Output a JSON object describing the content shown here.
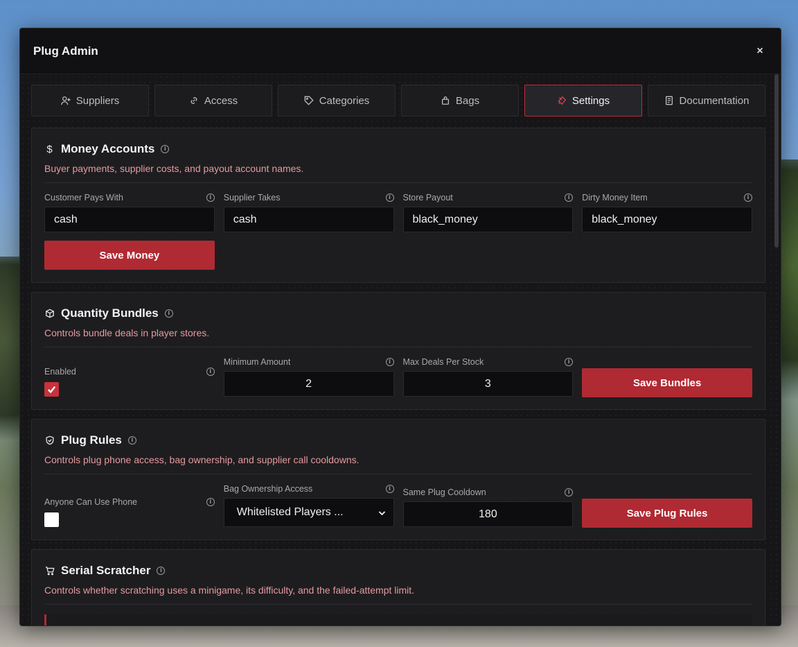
{
  "modal": {
    "title": "Plug Admin",
    "close": "×"
  },
  "tabs": [
    {
      "label": "Suppliers",
      "icon": "user-plus-icon"
    },
    {
      "label": "Access",
      "icon": "link-icon"
    },
    {
      "label": "Categories",
      "icon": "tag-icon"
    },
    {
      "label": "Bags",
      "icon": "bag-icon"
    },
    {
      "label": "Settings",
      "icon": "settings-icon",
      "active": true
    },
    {
      "label": "Documentation",
      "icon": "document-icon"
    }
  ],
  "money": {
    "title": "Money Accounts",
    "desc": "Buyer payments, supplier costs, and payout account names.",
    "fields": [
      {
        "label": "Customer Pays With",
        "value": "cash"
      },
      {
        "label": "Supplier Takes",
        "value": "cash"
      },
      {
        "label": "Store Payout",
        "value": "black_money"
      },
      {
        "label": "Dirty Money Item",
        "value": "black_money"
      }
    ],
    "save": "Save Money"
  },
  "bundles": {
    "title": "Quantity Bundles",
    "desc": "Controls bundle deals in player stores.",
    "enabled_label": "Enabled",
    "enabled": true,
    "min_label": "Minimum Amount",
    "min_value": "2",
    "max_label": "Max Deals Per Stock",
    "max_value": "3",
    "save": "Save Bundles"
  },
  "rules": {
    "title": "Plug Rules",
    "desc": "Controls plug phone access, bag ownership, and supplier call cooldowns.",
    "phone_label": "Anyone Can Use Phone",
    "phone_enabled": false,
    "bag_label": "Bag Ownership Access",
    "bag_value": "Whitelisted Players ...",
    "cooldown_label": "Same Plug Cooldown",
    "cooldown_value": "180",
    "save": "Save Plug Rules"
  },
  "scratcher": {
    "title": "Serial Scratcher",
    "desc": "Controls whether scratching uses a minigame, its difficulty, and the failed-attempt limit."
  },
  "colors": {
    "accent": "#b02a33",
    "desc": "#e59aa0",
    "bg": "#141416"
  }
}
